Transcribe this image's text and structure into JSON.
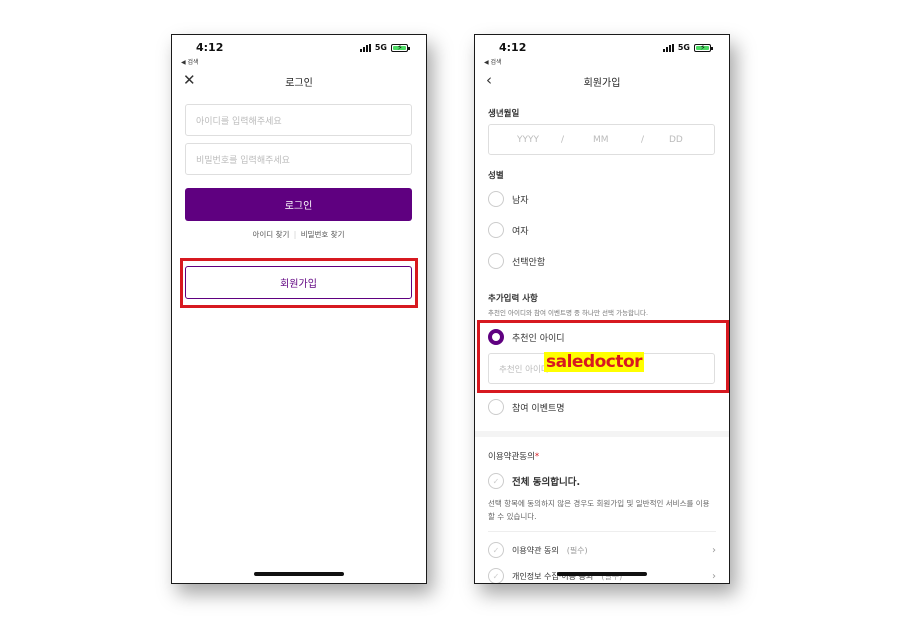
{
  "status": {
    "time": "4:12",
    "back_hint": "◀ 검색",
    "network": "5G"
  },
  "login": {
    "title": "로그인",
    "id_placeholder": "아이디를 입력해주세요",
    "pw_placeholder": "비밀번호를 입력해주세요",
    "login_button": "로그인",
    "find_id": "아이디 찾기",
    "separator": "|",
    "find_pw": "비밀번호 찾기",
    "signup_button": "회원가입"
  },
  "signup": {
    "title": "회원가입",
    "birth_label": "생년월일",
    "birth_yyyy": "YYYY",
    "birth_mm": "MM",
    "birth_dd": "DD",
    "slash": "/",
    "gender_label": "성별",
    "gender_options": [
      "남자",
      "여자",
      "선택안함"
    ],
    "extra_label": "추가입력 사항",
    "extra_hint": "추천인 아이디와 참여 이벤트명 중 하나만 선택 가능합니다.",
    "referrer_option": "추천인 아이디",
    "referrer_placeholder": "추천인 아이디",
    "event_option": "참여 이벤트명",
    "terms_label": "이용약관동의",
    "required_mark": "*",
    "agree_all": "전체 동의합니다.",
    "agree_all_desc": "선택 항목에 동의하지 않은 경우도 회원가입 및 일반적인 서비스를 이용할 수 있습니다.",
    "terms_items": [
      {
        "label": "이용약관 동의",
        "tag": "(필수)"
      },
      {
        "label": "개인정보 수집·이용 동의",
        "tag": "(필수)"
      }
    ]
  },
  "watermark": "saledoctor",
  "colors": {
    "brand": "#5f0080",
    "highlight": "#d71920"
  }
}
